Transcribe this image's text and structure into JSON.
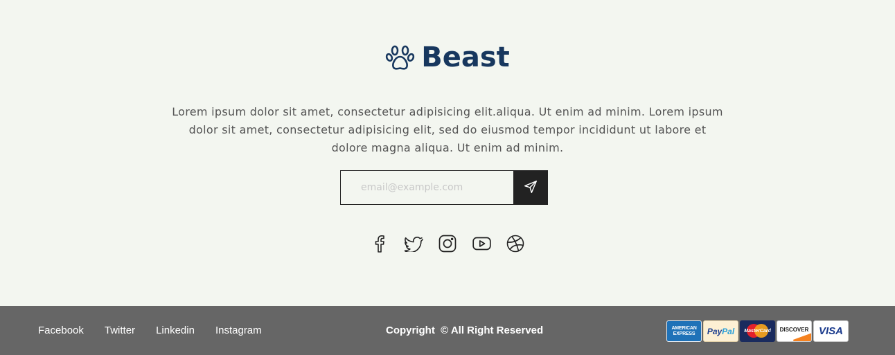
{
  "brand": {
    "name": "Beast",
    "icon": "paw-icon",
    "color": "#17375e"
  },
  "description": "Lorem ipsum dolor sit amet, consectetur adipisicing elit.aliqua. Ut enim ad minim. Lorem ipsum dolor sit amet, consectetur adipisicing elit, sed do eiusmod tempor incididunt ut labore et dolore magna aliqua. Ut enim ad minim.",
  "newsletter": {
    "placeholder": "email@example.com",
    "value": "",
    "submit_icon": "send-icon"
  },
  "socials": [
    {
      "name": "facebook",
      "icon": "facebook-icon"
    },
    {
      "name": "twitter",
      "icon": "twitter-icon"
    },
    {
      "name": "instagram",
      "icon": "instagram-icon"
    },
    {
      "name": "youtube",
      "icon": "youtube-icon"
    },
    {
      "name": "dribbble",
      "icon": "dribbble-icon"
    }
  ],
  "footer": {
    "links": [
      "Facebook",
      "Twitter",
      "Linkedin",
      "Instagram"
    ],
    "copyright": "Copyright  © All Right Reserved",
    "payments": {
      "amex_line1": "AMERICAN",
      "amex_line2": "EXPRESS",
      "paypal_a": "Pay",
      "paypal_b": "Pal",
      "mastercard": "MasterCard",
      "discover": "DISCOVER",
      "visa": "VISA"
    },
    "background": "#666666"
  },
  "colors": {
    "page_background": "#f3f6f0",
    "button_dark": "#222222",
    "text": "#555555"
  }
}
